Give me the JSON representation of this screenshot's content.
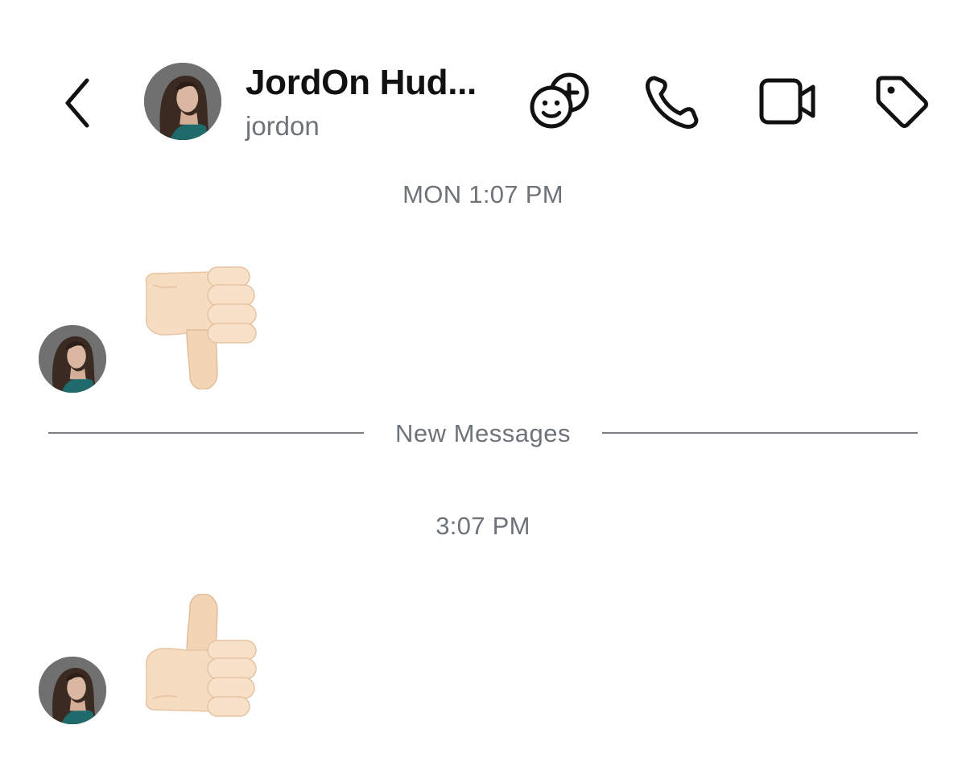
{
  "header": {
    "back_icon": "chevron-left-icon",
    "contact_name": "JordOn Hud...",
    "contact_username": "jordon",
    "actions": [
      {
        "name": "add-friend-icon",
        "label": "add-friend"
      },
      {
        "name": "phone-icon",
        "label": "call"
      },
      {
        "name": "video-camera-icon",
        "label": "video-call"
      },
      {
        "name": "tag-icon",
        "label": "tag"
      }
    ]
  },
  "conversation": {
    "first_timestamp": "MON 1:07 PM",
    "first_message_emoji": "thumbs-down",
    "divider_label": "New Messages",
    "second_timestamp": "3:07 PM",
    "second_message_emoji": "thumbs-up"
  },
  "colors": {
    "text_primary": "#111111",
    "text_secondary": "#6e7378",
    "divider": "#7b7f84",
    "skin_tone": "#f6dcc0"
  }
}
